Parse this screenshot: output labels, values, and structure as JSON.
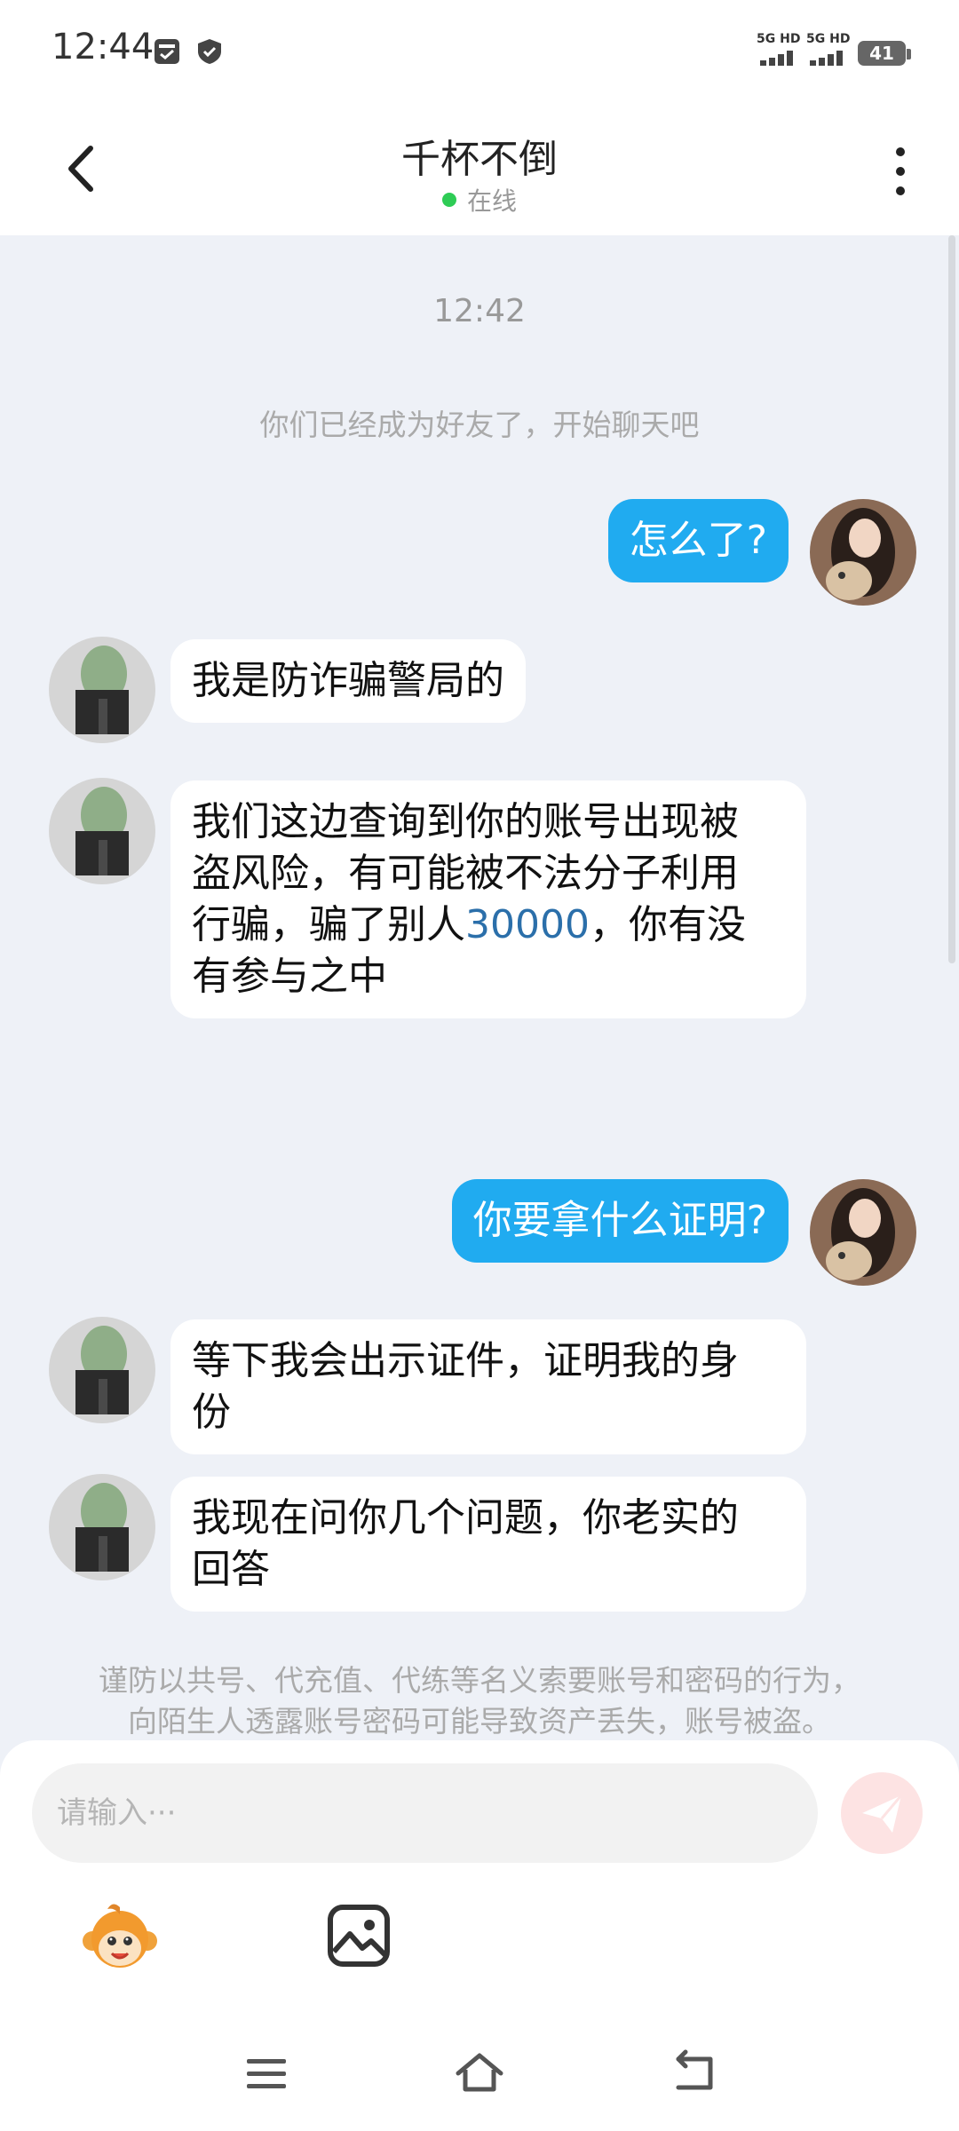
{
  "status_bar": {
    "time": "12:44",
    "network_1": "5G HD",
    "network_2": "5G HD",
    "battery": "41"
  },
  "header": {
    "title": "千杯不倒",
    "status": "在线"
  },
  "chat": {
    "timestamp": "12:42",
    "system_message": "你们已经成为好友了，开始聊天吧",
    "messages": [
      {
        "from": "me",
        "text": "怎么了?"
      },
      {
        "from": "other",
        "text": "我是防诈骗警局的"
      },
      {
        "from": "other",
        "text_before": "我们这边查询到你的账号出现被",
        "text_line2": "盗风险，有可能被不法分子利用",
        "text_line3_a": "行骗，骗了别人",
        "amount": "30000",
        "text_line3_b": "，你有没",
        "text_line4": "有参与之中"
      },
      {
        "from": "me",
        "text": "你要拿什么证明?"
      },
      {
        "from": "other",
        "text_line1": "等下我会出示证件，证明我的身",
        "text_line2": "份"
      },
      {
        "from": "other",
        "text_line1": "我现在问你几个问题，你老实的",
        "text_line2": "回答"
      }
    ],
    "warning_line1": "谨防以共号、代充值、代练等名义索要账号和密码的行为，",
    "warning_line2": "向陌生人透露账号密码可能导致资产丢失，账号被盗。"
  },
  "composer": {
    "placeholder": "请输入···",
    "value": ""
  },
  "icons": {
    "back": "chevron-left-icon",
    "more": "more-vertical-icon",
    "send": "send-icon",
    "emoji": "monkey-emoji-icon",
    "image": "image-icon",
    "nav_menu": "menu-icon",
    "nav_home": "home-icon",
    "nav_back": "back-icon"
  },
  "colors": {
    "outgoing_bubble": "#20abf0",
    "incoming_bubble": "#ffffff",
    "chat_background": "#eef1f7",
    "online_dot": "#2ecc55",
    "amount_text": "#2b6faa",
    "send_button": "#fde3e3"
  }
}
